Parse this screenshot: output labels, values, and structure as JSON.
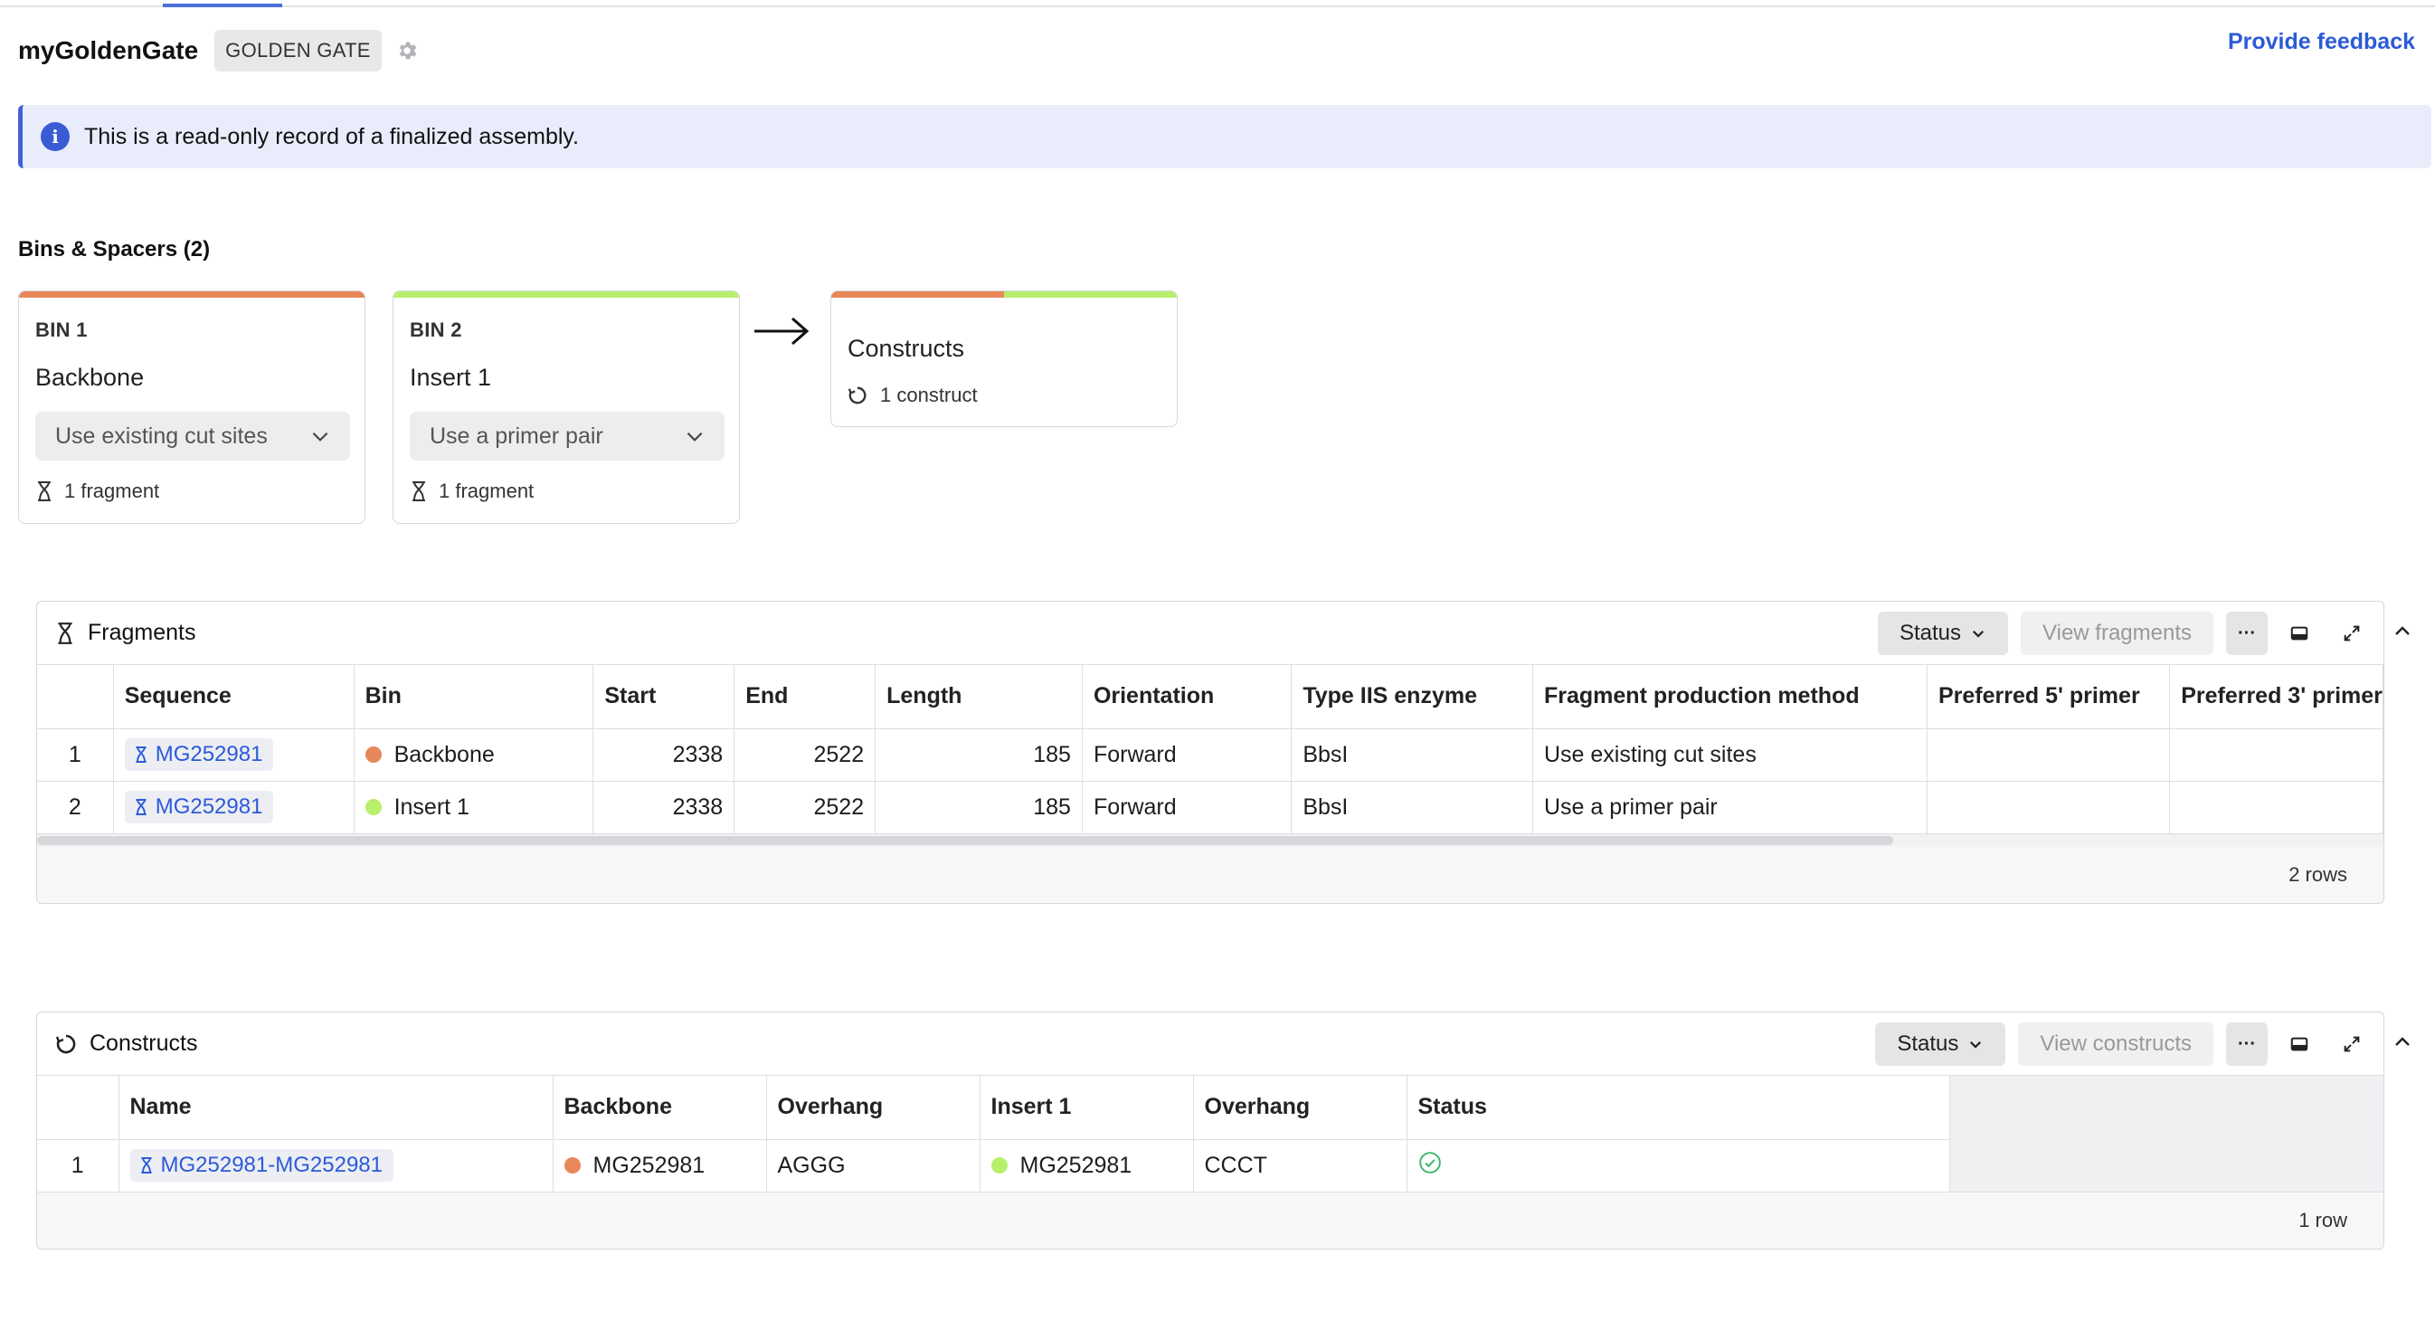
{
  "header": {
    "app_title": "myGoldenGate",
    "env_badge": "GOLDEN GATE",
    "feedback_link": "Provide feedback"
  },
  "banner": {
    "message": "This is a read-only record of a finalized assembly."
  },
  "bins_section": {
    "title": "Bins & Spacers (2)",
    "bins": [
      {
        "label": "BIN 1",
        "name": "Backbone",
        "method": "Use existing cut sites",
        "fragments": "1 fragment",
        "color": "#e8875a"
      },
      {
        "label": "BIN 2",
        "name": "Insert 1",
        "method": "Use a primer pair",
        "fragments": "1 fragment",
        "color": "#b8ef6b"
      }
    ],
    "constructs": {
      "title": "Constructs",
      "count": "1 construct"
    }
  },
  "fragments_panel": {
    "title": "Fragments",
    "status_button": "Status",
    "view_button": "View fragments",
    "more_button": "···",
    "columns": [
      "Sequence",
      "Bin",
      "Start",
      "End",
      "Length",
      "Orientation",
      "Type IIS enzyme",
      "Fragment production method",
      "Preferred 5' primer",
      "Preferred 3' primer"
    ],
    "rows": [
      {
        "index": "1",
        "sequence": "MG252981",
        "bin": "Backbone",
        "bin_color": "#e8875a",
        "start": "2338",
        "end": "2522",
        "length": "185",
        "orientation": "Forward",
        "enzyme": "BbsI",
        "method": "Use existing cut sites",
        "primer5": "",
        "primer3": ""
      },
      {
        "index": "2",
        "sequence": "MG252981",
        "bin": "Insert 1",
        "bin_color": "#b8ef6b",
        "start": "2338",
        "end": "2522",
        "length": "185",
        "orientation": "Forward",
        "enzyme": "BbsI",
        "method": "Use a primer pair",
        "primer5": "",
        "primer3": ""
      }
    ],
    "row_count": "2 rows"
  },
  "constructs_panel": {
    "title": "Constructs",
    "status_button": "Status",
    "view_button": "View constructs",
    "more_button": "···",
    "columns": [
      "Name",
      "Backbone",
      "Overhang",
      "Insert 1",
      "Overhang",
      "Status"
    ],
    "rows": [
      {
        "index": "1",
        "name": "MG252981-MG252981",
        "backbone": "MG252981",
        "overhang1": "AGGG",
        "insert": "MG252981",
        "overhang2": "CCCT",
        "status": "check-circle-icon"
      }
    ],
    "row_count": "1 row"
  },
  "colors": {
    "accent": "#2c5ad8",
    "banner_bg": "#e9edfb",
    "bin1": "#e8875a",
    "bin2": "#b8ef6b",
    "success": "#3fb56a"
  }
}
